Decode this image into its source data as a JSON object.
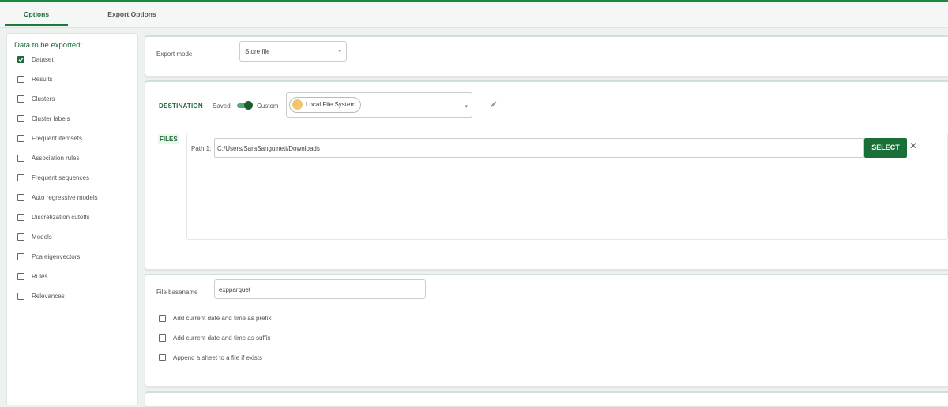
{
  "tabs": [
    {
      "label": "Options",
      "active": true
    },
    {
      "label": "Export Options",
      "active": false
    }
  ],
  "left_panel": {
    "title": "Data to be exported:",
    "items": [
      {
        "label": "Dataset",
        "checked": true
      },
      {
        "label": "Results",
        "checked": false
      },
      {
        "label": "Clusters",
        "checked": false
      },
      {
        "label": "Cluster labels",
        "checked": false
      },
      {
        "label": "Frequent itemsets",
        "checked": false
      },
      {
        "label": "Association rules",
        "checked": false
      },
      {
        "label": "Frequent sequences",
        "checked": false
      },
      {
        "label": "Auto regressive models",
        "checked": false
      },
      {
        "label": "Discretization cutoffs",
        "checked": false
      },
      {
        "label": "Models",
        "checked": false
      },
      {
        "label": "Pca eigenvectors",
        "checked": false
      },
      {
        "label": "Rules",
        "checked": false
      },
      {
        "label": "Relevances",
        "checked": false
      }
    ]
  },
  "export_mode": {
    "label": "Export mode",
    "value": "Store file"
  },
  "destination": {
    "label": "DESTINATION",
    "saved_label": "Saved",
    "custom_label": "Custom",
    "toggle_on": true,
    "source": "Local File System",
    "files_label": "FILES",
    "path_label": "Path 1:",
    "path_value": "C:/Users/SaraSanguineti/Downloads",
    "select_button": "SELECT",
    "remove_icon": "close-icon",
    "edit_icon": "pencil-icon"
  },
  "file_options": {
    "basename_label": "File basename",
    "basename_value": "expparquet",
    "checkboxes": [
      {
        "label": "Add current date and time as prefix",
        "checked": false
      },
      {
        "label": "Add current date and time as suffix",
        "checked": false
      },
      {
        "label": "Append a sheet to a file if exists",
        "checked": false
      }
    ]
  },
  "colors": {
    "accent": "#1f6b3a",
    "button": "#1a6e38",
    "top_bar": "#1a8a3e"
  }
}
